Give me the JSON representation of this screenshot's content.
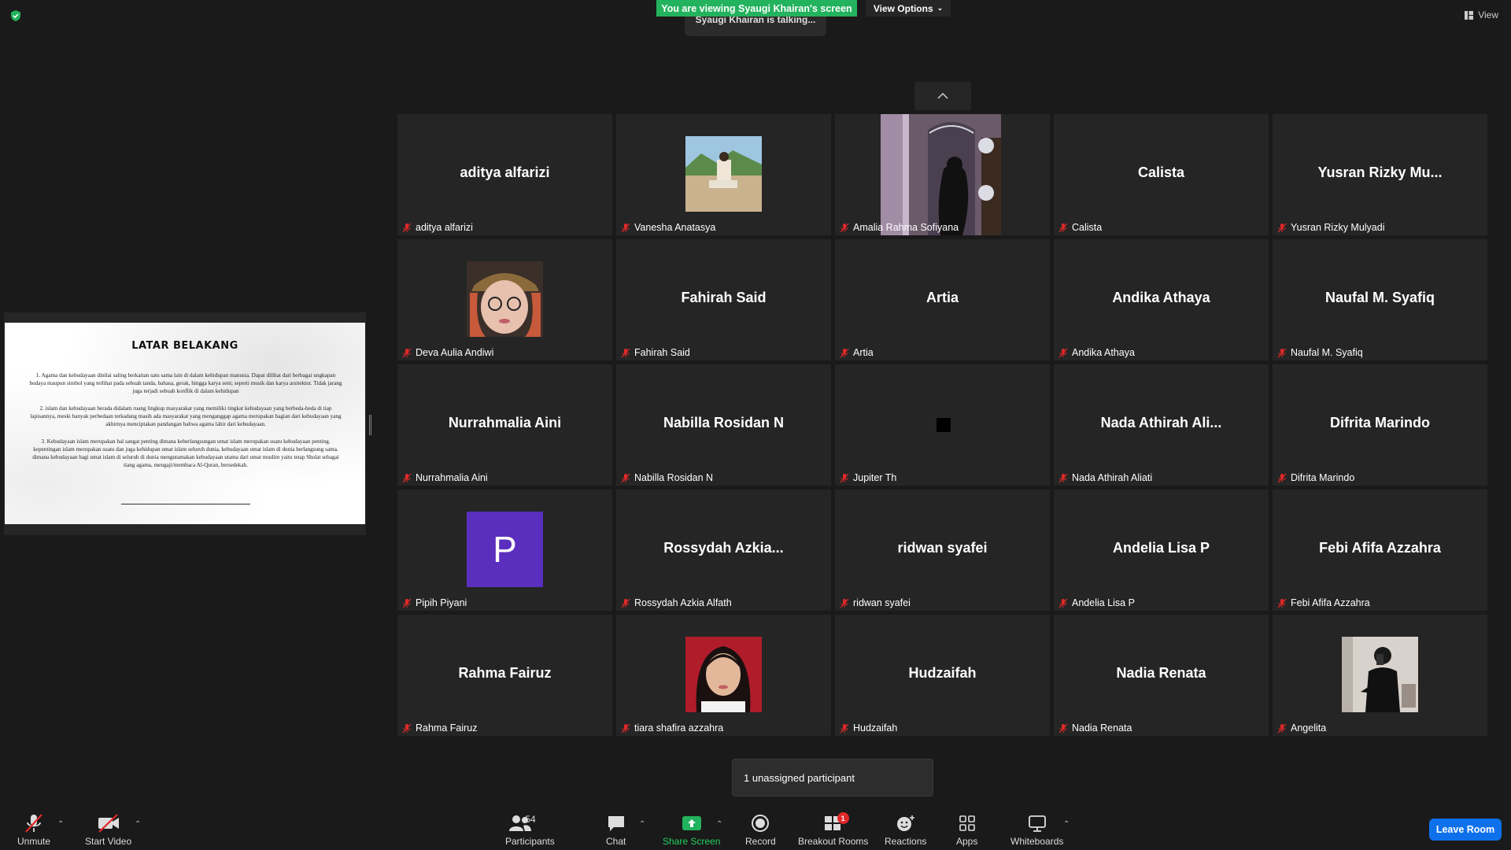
{
  "banner": {
    "viewing": "You are viewing Syaugi Khairan's screen",
    "view_options": "View Options",
    "talking": "Syaugi Khairan is talking...",
    "view": "View"
  },
  "slide": {
    "title": "LATAR BELAKANG",
    "p1": "1.   Agama dan kebudayaan dinilai saling berkaitan satu sama lain di dalam kehidupan manusia. Dapat dilihat dari berbagai ungkapan budaya maupun simbol yang terlihat pada sebuah tanda, bahasa, gerak, hingga karya seni; seperti musik dan karya arsitektur. Tidak jarang juga terjadi sebuah konflik di dalam kehidupan",
    "p2": "2. islam dan kebudayaan berada didalam ruang lingkup masyarakat yang memiliki tingkat kebudayaan yang berbeda-beda di tiap lapisannya, meski banyak perbedaan terkadang masih ada masyarakat yang menganggap agama merupakan bagian dari kebudayaan yang akhirnya menciptakan pandangan bahwa agama lahir dari kebudayaan.",
    "p3": "3.  Kebudayaan islam merupakan hal sangat penting dimana keberlangsungan umat islam merupakan suatu kebudayaan penting. kepentingan islam merupakan suatu dan juga kehidupan umat islam seluruh dunia, kebudayaan umat islam di dunia berlangsung sama. dimana kebudayaan bagi umat islam di seluruh di dunia mengutamakan kebudayaan utama dari umat muslim yaitu tetap Sholat sebagai tiang agama, mengaji/membaca Al-Quran, bersedekah."
  },
  "tiles": [
    {
      "big": "aditya alfarizi",
      "label": "aditya alfarizi",
      "kind": "name"
    },
    {
      "big": "",
      "label": "Vanesha Anatasya",
      "kind": "photo",
      "photo": "beach"
    },
    {
      "big": "",
      "label": "Amalia Rahma Sofiyana",
      "kind": "video"
    },
    {
      "big": "Calista",
      "label": "Calista",
      "kind": "name"
    },
    {
      "big": "Yusran Rizky Mu...",
      "label": "Yusran Rizky Mulyadi",
      "kind": "name"
    },
    {
      "big": "",
      "label": "Deva Aulia Andiwi",
      "kind": "photo",
      "photo": "hat"
    },
    {
      "big": "Fahirah Said",
      "label": "Fahirah Said",
      "kind": "name"
    },
    {
      "big": "Artia",
      "label": "Artia",
      "kind": "name"
    },
    {
      "big": "Andika Athaya",
      "label": "Andika Athaya",
      "kind": "name"
    },
    {
      "big": "Naufal M. Syafiq",
      "label": "Naufal M. Syafiq",
      "kind": "name"
    },
    {
      "big": "Nurrahmalia Aini",
      "label": "Nurrahmalia Aini",
      "kind": "name"
    },
    {
      "big": "Nabilla Rosidan N",
      "label": "Nabilla Rosidan N",
      "kind": "name"
    },
    {
      "big": "",
      "label": "Jupiter Th",
      "kind": "black"
    },
    {
      "big": "Nada Athirah Ali...",
      "label": "Nada Athirah Aliati",
      "kind": "name"
    },
    {
      "big": "Difrita Marindo",
      "label": "Difrita Marindo",
      "kind": "name"
    },
    {
      "big": "P",
      "label": "Pipih Piyani",
      "kind": "letter"
    },
    {
      "big": "Rossydah  Azkia...",
      "label": "Rossydah Azkia Alfath",
      "kind": "name"
    },
    {
      "big": "ridwan syafei",
      "label": "ridwan syafei",
      "kind": "name"
    },
    {
      "big": "Andelia Lisa P",
      "label": "Andelia Lisa P",
      "kind": "name"
    },
    {
      "big": "Febi Afifa Azzahra",
      "label": "Febi Afifa Azzahra",
      "kind": "name"
    },
    {
      "big": "Rahma Fairuz",
      "label": "Rahma Fairuz",
      "kind": "name"
    },
    {
      "big": "",
      "label": "tiara shafira azzahra",
      "kind": "photo",
      "photo": "girl"
    },
    {
      "big": "Hudzaifah",
      "label": "Hudzaifah",
      "kind": "name"
    },
    {
      "big": "Nadia Renata",
      "label": "Nadia Renata",
      "kind": "name"
    },
    {
      "big": "",
      "label": "Angelita",
      "kind": "photo",
      "photo": "mirror"
    }
  ],
  "toast": {
    "text": "1 unassigned participant"
  },
  "toolbar": {
    "unmute": "Unmute",
    "start_video": "Start Video",
    "participants": "Participants",
    "participants_count": "54",
    "chat": "Chat",
    "share_screen": "Share Screen",
    "record": "Record",
    "breakout_rooms": "Breakout Rooms",
    "breakout_badge": "1",
    "reactions": "Reactions",
    "apps": "Apps",
    "whiteboards": "Whiteboards",
    "leave_room": "Leave Room"
  },
  "colors": {
    "share_green": "#23b25d",
    "leave_blue": "#0e71eb",
    "muted_red": "#e02828",
    "avatar_purple": "#5a2fbe"
  }
}
